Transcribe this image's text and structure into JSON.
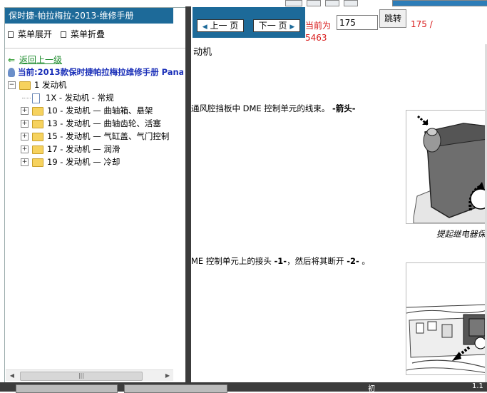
{
  "left_panel": {
    "title": "保时捷-帕拉梅拉-2013-维修手册",
    "expand_label": "菜单展开",
    "collapse_label": "菜单折叠",
    "back_label": "返回上一级",
    "current_label": "当前:2013款保时捷帕拉梅拉维修手册 Panam",
    "tree": {
      "root": "1 发动机",
      "items": [
        {
          "label": "1X - 发动机 - 常规",
          "type": "doc"
        },
        {
          "label": "10 - 发动机 — 曲轴箱、悬架",
          "type": "folder"
        },
        {
          "label": "13 - 发动机 — 曲轴齿轮、活塞",
          "type": "folder"
        },
        {
          "label": "15 - 发动机 — 气缸盖、气门控制",
          "type": "folder"
        },
        {
          "label": "17 - 发动机 — 润滑",
          "type": "folder"
        },
        {
          "label": "19 - 发动机 — 冷却",
          "type": "folder"
        }
      ]
    },
    "scrollbar_grip": "|||"
  },
  "nav": {
    "prev_label": "上一 页",
    "next_label": "下一 页",
    "current_prefix": "当前为",
    "page_value": "175",
    "go_label": "跳转",
    "total_a": "175 /",
    "total_b": "5463"
  },
  "content": {
    "heading": "动机",
    "para1_text": "通风腔挡板中  DME 控制单元的线束。 ",
    "para1_tag": "-箭头-",
    "fig1_caption": "提起继电器保",
    "para2_a": "ME 控制单元上的接头 ",
    "para2_tag1": "-1-",
    "para2_b": "，然后将其断开 ",
    "para2_tag2": "-2-",
    "para2_c": " 。"
  },
  "status": {
    "mid": "初",
    "right": "1.1"
  }
}
